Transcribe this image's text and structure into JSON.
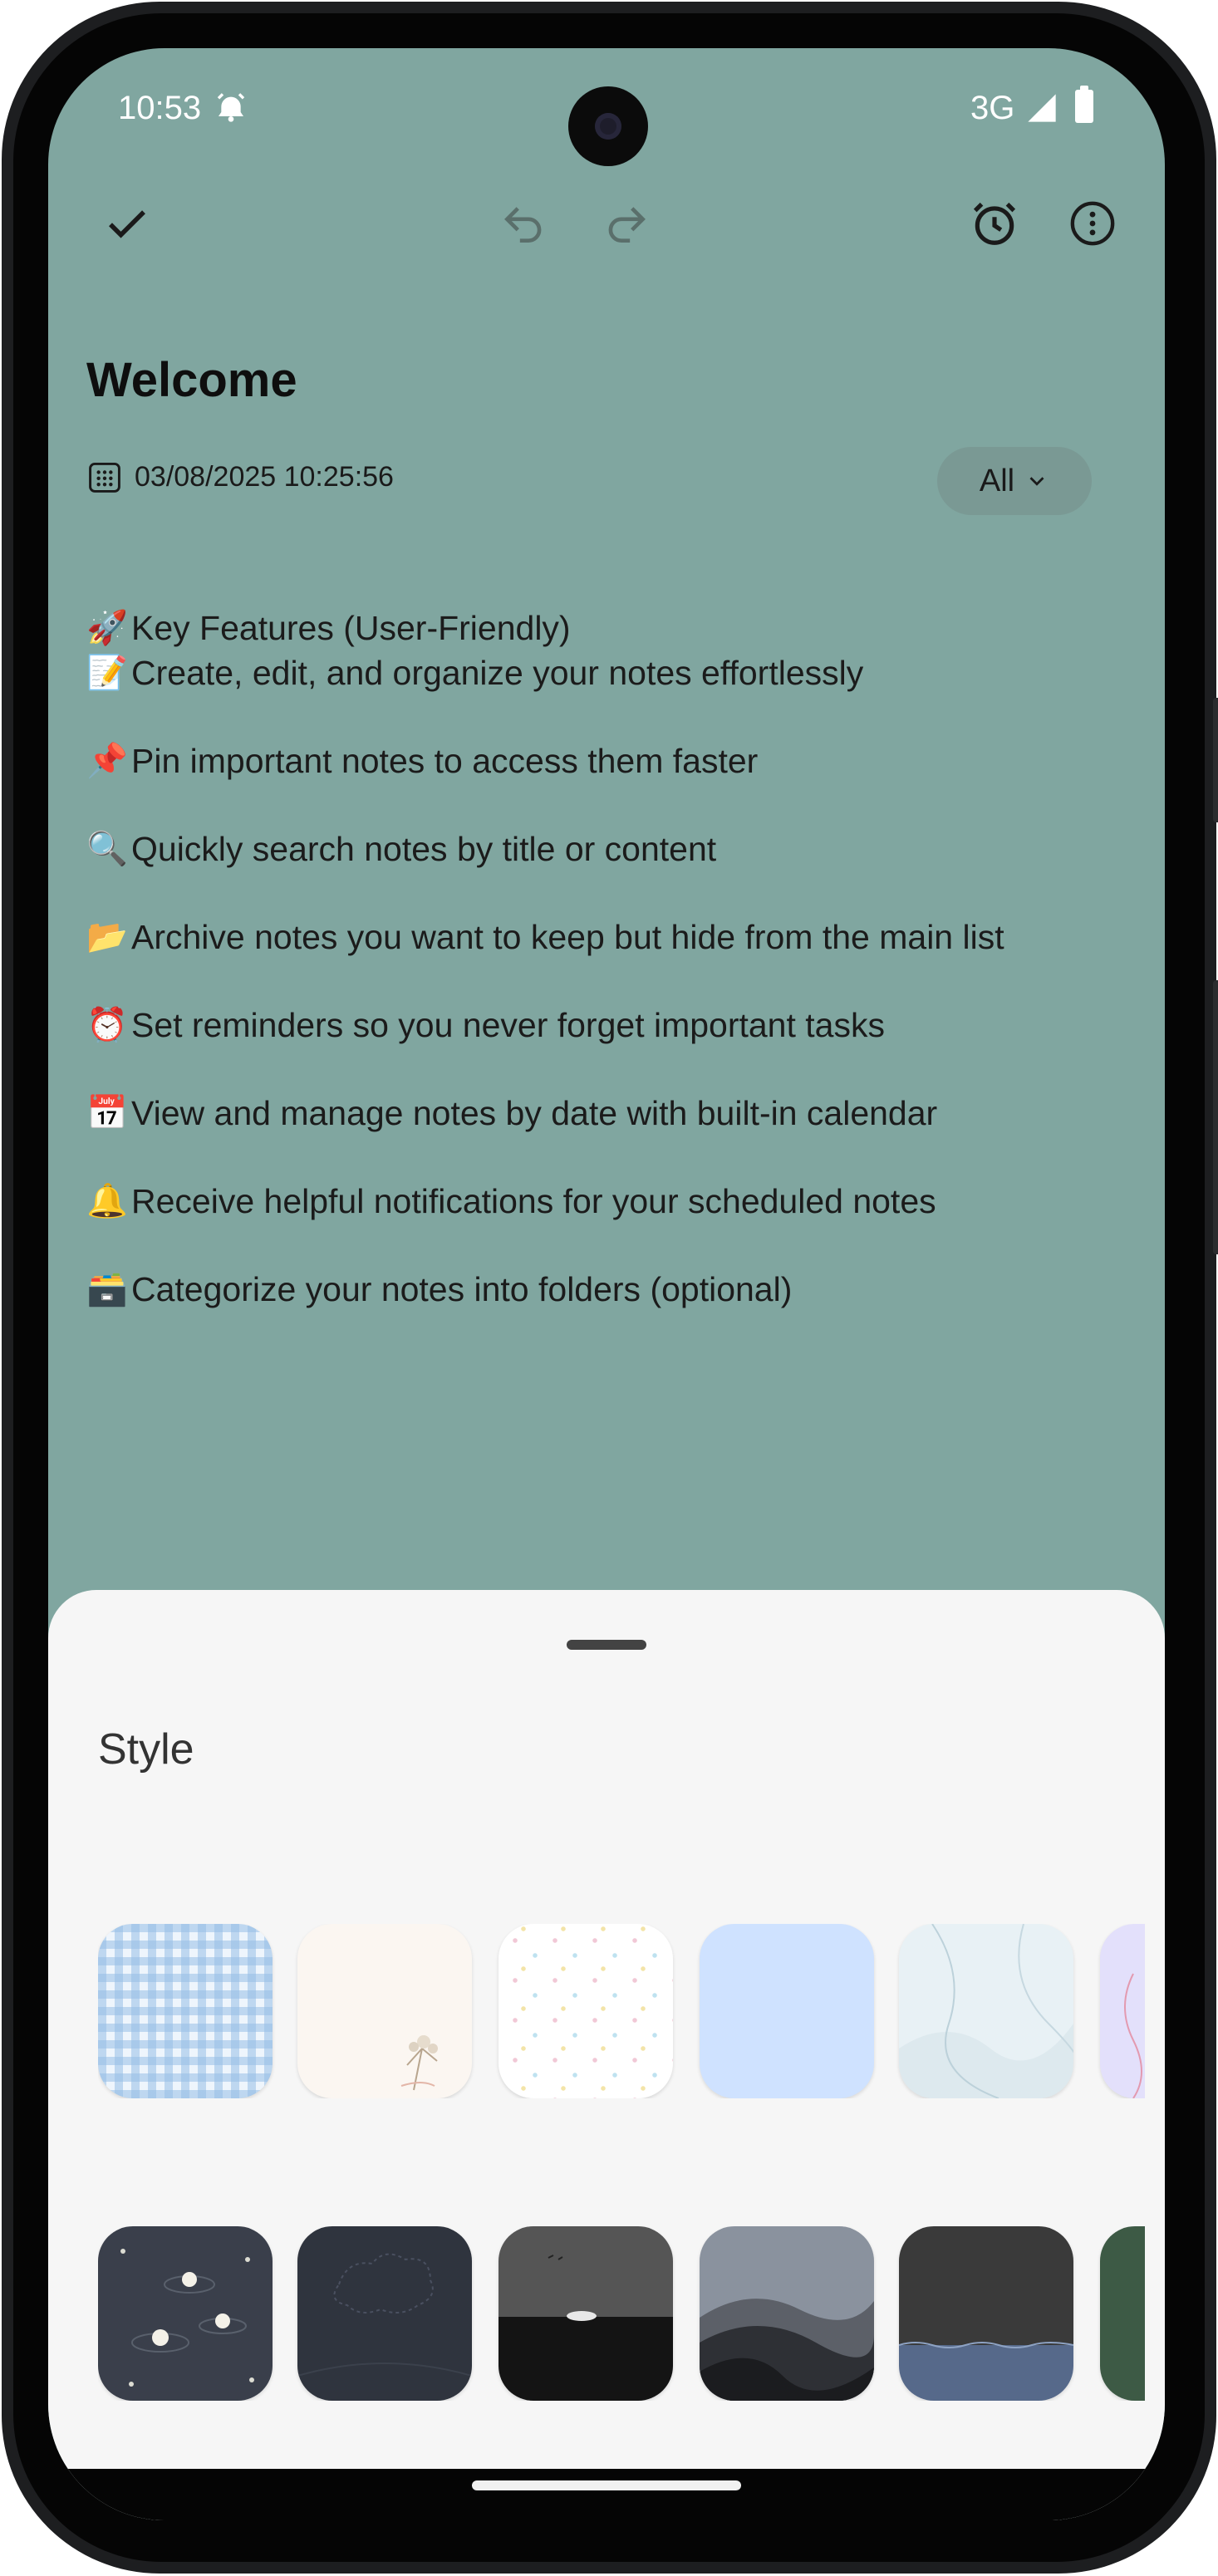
{
  "statusbar": {
    "time": "10:53",
    "network": "3G"
  },
  "toolbar": {
    "confirm_icon": "check-icon",
    "undo_icon": "undo-icon",
    "redo_icon": "redo-icon",
    "reminder_icon": "alarm-clock-icon",
    "more_icon": "more-vertical-icon"
  },
  "note": {
    "title": "Welcome",
    "datetime": "03/08/2025 10:25:56",
    "category": "All",
    "lines": [
      {
        "emoji": "🚀",
        "text": "Key Features (User-Friendly)"
      },
      {
        "emoji": "📝",
        "text": "Create, edit, and organize your notes effortlessly"
      },
      {
        "emoji": "📌",
        "text": "Pin important notes to access them faster"
      },
      {
        "emoji": "🔍",
        "text": "Quickly search notes by title or content"
      },
      {
        "emoji": "📂",
        "text": "Archive notes you want to keep but hide from the main list"
      },
      {
        "emoji": "⏰",
        "text": "Set reminders so you never forget important tasks"
      },
      {
        "emoji": "📅",
        "text": "View and manage notes by date with built-in calendar"
      },
      {
        "emoji": "🔔",
        "text": "Receive helpful notifications for your scheduled notes"
      },
      {
        "emoji": "🗃️",
        "text": "Categorize your notes into folders (optional)"
      }
    ]
  },
  "sheet": {
    "title": "Style",
    "light_styles": [
      "blue-gingham",
      "cream-flower",
      "dotted-confetti",
      "light-blue",
      "pale-waves",
      "lavender"
    ],
    "dark_styles": [
      "ducks-pond",
      "dark-slate-cloud",
      "night-sea",
      "dunes",
      "dark-ocean",
      "forest-green"
    ]
  },
  "colors": {
    "note_background": "#80a6a0",
    "sheet_background": "#f6f6f6"
  }
}
